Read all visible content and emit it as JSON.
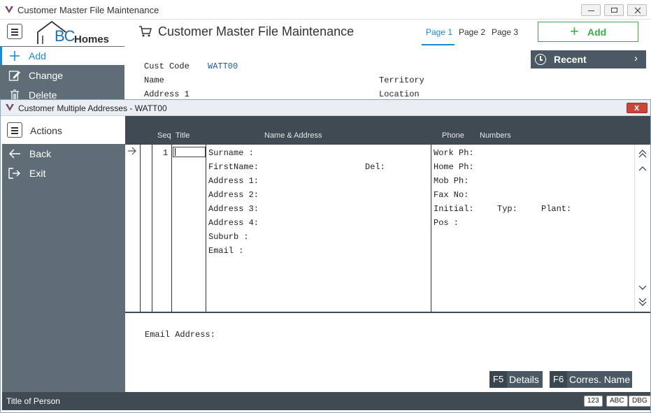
{
  "main_window": {
    "title": "Customer Master File Maintenance",
    "page_title": "Customer Master File Maintenance",
    "logo": {
      "bc": "BC",
      "homes": "Homes"
    },
    "page_tabs": [
      {
        "label": "Page 1",
        "active": true
      },
      {
        "label": "Page 2",
        "active": false
      },
      {
        "label": "Page 3",
        "active": false
      }
    ],
    "add_button_label": "Add",
    "recent_label": "Recent",
    "sidebar": [
      {
        "label": "Add",
        "icon": "plus-icon"
      },
      {
        "label": "Change",
        "icon": "edit-icon"
      },
      {
        "label": "Delete",
        "icon": "trash-icon"
      }
    ],
    "fields": {
      "cust_code_label": "Cust Code",
      "cust_code_value": "WATT00",
      "name_label": "Name",
      "address1_label": "Address 1",
      "territory_label": "Territory",
      "location_label": "Location"
    }
  },
  "dialog": {
    "title": "Customer Multiple Addresses  - WATT00",
    "close_label": "x",
    "actions_label": "Actions",
    "sidebar": [
      {
        "label": "Back",
        "icon": "arrow-left-icon"
      },
      {
        "label": "Exit",
        "icon": "exit-icon"
      }
    ],
    "grid": {
      "headers": {
        "seq": "Seq",
        "title": "Title",
        "name_address": "Name & Address",
        "phone": "Phone",
        "numbers": "Numbers"
      },
      "row": {
        "seq": "1",
        "name_address_lines": [
          "Surname  :",
          "FirstName:",
          "Address 1:",
          "Address 2:",
          "Address 3:",
          "Address 4:",
          "Suburb   :",
          "Email    :"
        ],
        "del_label": "Del:",
        "phone_lines": [
          "Work Ph:",
          "Home Ph:",
          "Mob  Ph:",
          "Fax  No:"
        ],
        "initial_label": "Initial:",
        "typ_label": "Typ:",
        "plant_label": "Plant:",
        "pos_label": "Pos    :"
      }
    },
    "email_address_label": "Email Address:",
    "function_keys": [
      {
        "key": "F5",
        "label": "Details"
      },
      {
        "key": "F6",
        "label": "Corres. Name"
      }
    ],
    "status": {
      "text": "Title of Person",
      "badges": [
        "123",
        "ABC",
        "DBG"
      ]
    }
  },
  "colors": {
    "accent_blue": "#1a8ad4",
    "add_green": "#3aaa4a",
    "sidebar_slate": "#5f6d77",
    "header_dark": "#3f4a53",
    "close_red": "#c9463a"
  }
}
